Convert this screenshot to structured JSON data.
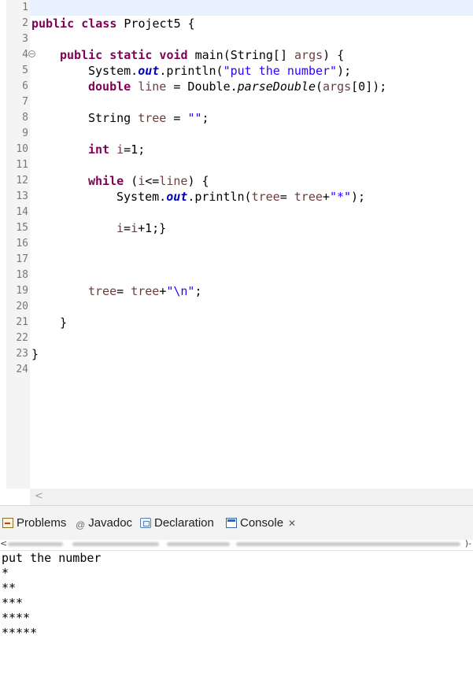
{
  "editor": {
    "line_numbers": [
      "1",
      "2",
      "3",
      "4",
      "5",
      "6",
      "7",
      "8",
      "9",
      "10",
      "11",
      "12",
      "13",
      "14",
      "15",
      "16",
      "17",
      "18",
      "19",
      "20",
      "21",
      "22",
      "23",
      "24"
    ],
    "code": {
      "l2_kw": "public class ",
      "l2_name": "Project5 {",
      "l4_kw": "public static void ",
      "l4_rest": "main(String[] ",
      "l4_var": "args",
      "l4_end": ") {",
      "l5_a": "System.",
      "l5_out": "out",
      "l5_b": ".println(",
      "l5_str": "\"put the number\"",
      "l5_end": ");",
      "l6_kw": "double ",
      "l6_var": "line",
      "l6_b": " = Double.",
      "l6_it": "parseDouble",
      "l6_c": "(",
      "l6_var2": "args",
      "l6_end": "[0]);",
      "l8_a": "String ",
      "l8_var": "tree",
      "l8_b": " = ",
      "l8_str": "\"\"",
      "l8_end": ";",
      "l10_kw": "int ",
      "l10_var": "i",
      "l10_end": "=1;",
      "l12_kw": "while ",
      "l12_a": "(",
      "l12_var": "i",
      "l12_b": "<=",
      "l12_var2": "line",
      "l12_end": ") {",
      "l13_a": "System.",
      "l13_out": "out",
      "l13_b": ".println(",
      "l13_var": "tree",
      "l13_c": "= ",
      "l13_var2": "tree",
      "l13_d": "+",
      "l13_str": "\"*\"",
      "l13_end": ");",
      "l15_var": "i",
      "l15_b": "=",
      "l15_var2": "i",
      "l15_end": "+1;}",
      "l19_var": "tree",
      "l19_b": "= ",
      "l19_var2": "tree",
      "l19_c": "+",
      "l19_str": "\"\\n\"",
      "l19_end": ";",
      "l21": "}",
      "l23": "}"
    }
  },
  "views": {
    "tabs": [
      "Problems",
      "Javadoc",
      "Declaration",
      "Console"
    ],
    "javadoc_prefix": "@",
    "close_glyph": "✕"
  },
  "console": {
    "header_left": "<",
    "header_right": ")-",
    "output": [
      "put the number",
      "*",
      "**",
      "***",
      "****",
      "*****"
    ]
  }
}
